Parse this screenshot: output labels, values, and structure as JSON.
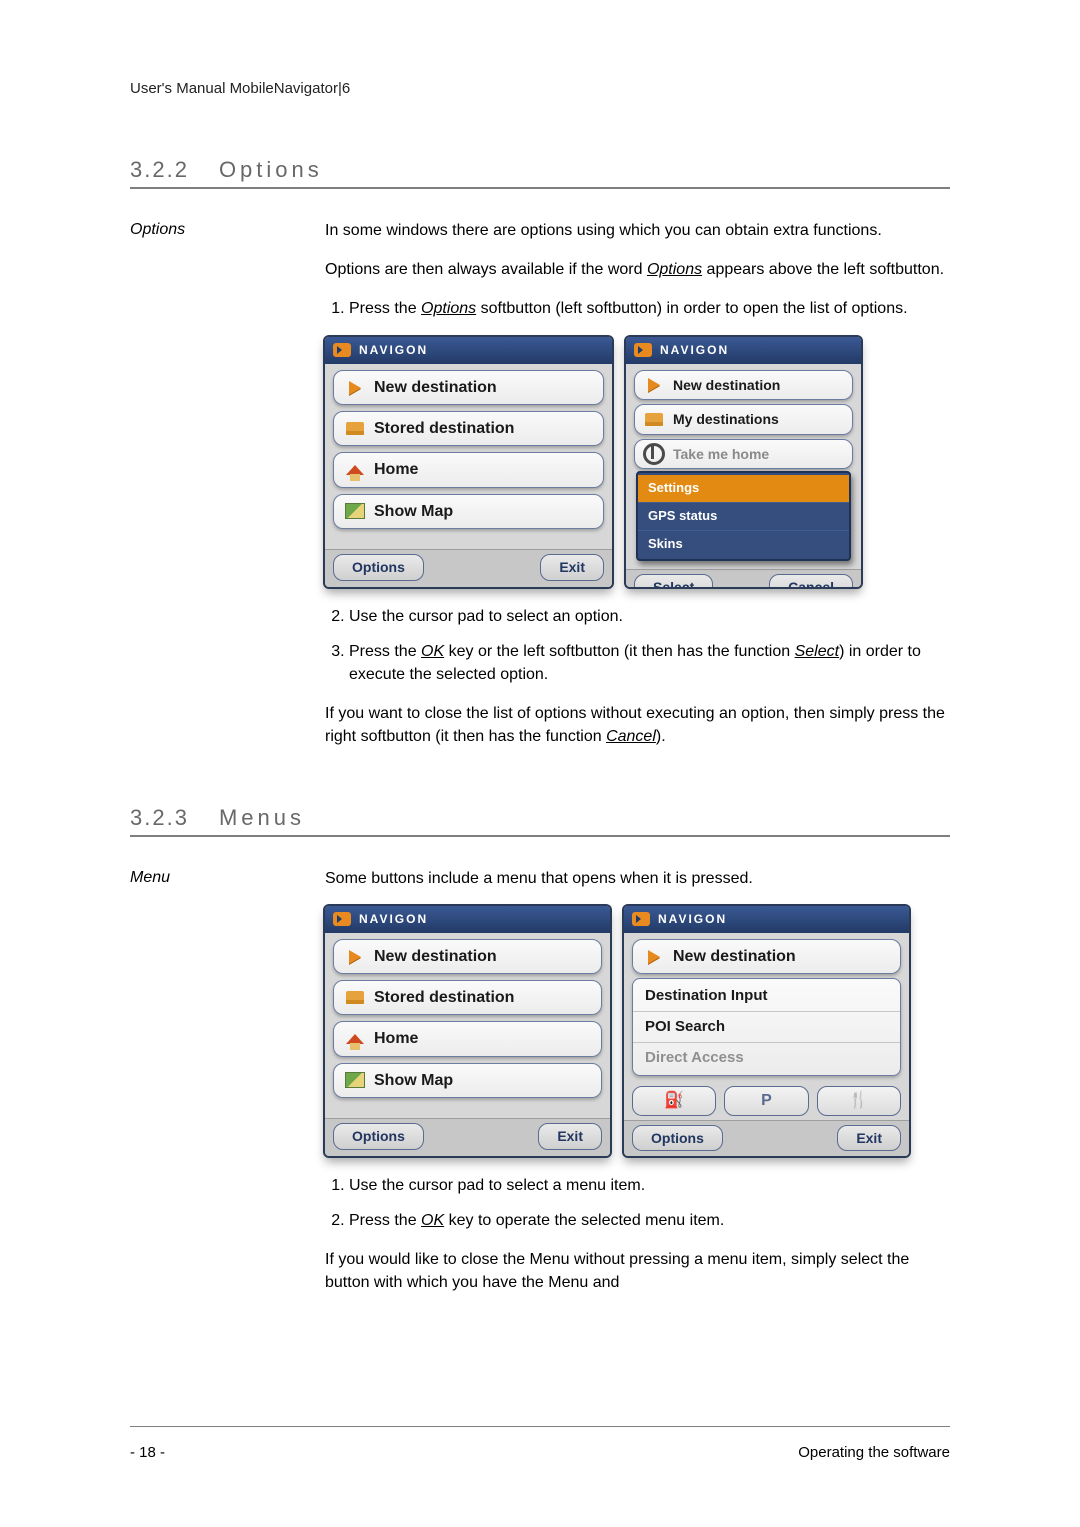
{
  "running_head": "User's Manual MobileNavigator|6",
  "sections": {
    "options": {
      "num": "3.2.2",
      "title": "Options",
      "margin": "Options",
      "p1a": "In some windows there are options using which you can obtain extra functions.",
      "p1b_a": "Options are then always available if the word ",
      "p1b_u": "Options",
      "p1b_c": " appears above the left softbutton.",
      "step1_a": "Press the ",
      "step1_u": "Options",
      "step1_b": " softbutton (left softbutton) in order to open the list of options.",
      "step2": "Use the cursor pad to select an option.",
      "step3_a": "Press the ",
      "step3_u1": "OK",
      "step3_b": " key or the left softbutton (it then has the function ",
      "step3_u2": "Select",
      "step3_c": ") in order to execute the selected option.",
      "p2_a": "If you want to close the list of options without executing an option, then simply press the right softbutton (it then has the function ",
      "p2_u": "Cancel",
      "p2_b": ")."
    },
    "menus": {
      "num": "3.2.3",
      "title": "Menus",
      "margin": "Menu",
      "p1": "Some buttons include a menu that opens when it is pressed.",
      "step1": "Use the cursor pad to select a menu item.",
      "step2_a": "Press the ",
      "step2_u": "OK",
      "step2_b": " key to operate the selected menu item.",
      "p2": "If you would like to close the Menu without pressing a menu item, simply select the button with which you have the Menu and"
    }
  },
  "device": {
    "brand": "NAVIGON",
    "items": {
      "new_destination": "New destination",
      "stored_destination": "Stored destination",
      "my_destinations": "My destinations",
      "take_me_home": "Take me home",
      "home": "Home",
      "show_map": "Show Map",
      "destination_input": "Destination Input",
      "poi_search": "POI Search",
      "direct_access": "Direct Access"
    },
    "popup": {
      "settings": "Settings",
      "gps_status": "GPS status",
      "skins": "Skins"
    },
    "soft": {
      "options": "Options",
      "exit": "Exit",
      "select": "Select",
      "cancel": "Cancel"
    },
    "quick_p": "P"
  },
  "footer": {
    "page": "- 18 -",
    "chapter": "Operating the software"
  }
}
